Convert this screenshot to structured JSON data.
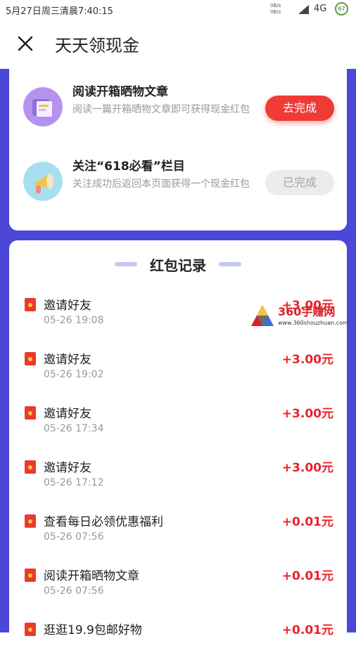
{
  "status_bar": {
    "time": "5月27日周三清晨7:40:15",
    "net_up": "0B/s",
    "net_down": "0B/s",
    "network": "4G",
    "battery": "67",
    "icons": [
      "signal-icon",
      "battery-icon"
    ]
  },
  "title_bar": {
    "close_icon": "close-icon",
    "title": "天天领现金"
  },
  "tasks": [
    {
      "title": "阅读开箱晒物文章",
      "desc": "阅读一篇开箱晒物文章即可获得现金红包",
      "button": "去完成",
      "state": "active",
      "icon": "article-icon",
      "icon_color": "#b493ef"
    },
    {
      "title": "关注“618必看”栏目",
      "desc": "关注成功后返回本页面获得一个现金红包",
      "button": "已完成",
      "state": "done",
      "icon": "megaphone-icon",
      "icon_color": "#a7dff0"
    }
  ],
  "records_title": "红包记录",
  "records": [
    {
      "name": "邀请好友",
      "date": "05-26 19:08",
      "amount": "+3.00元"
    },
    {
      "name": "邀请好友",
      "date": "05-26 19:02",
      "amount": "+3.00元"
    },
    {
      "name": "邀请好友",
      "date": "05-26 17:34",
      "amount": "+3.00元"
    },
    {
      "name": "邀请好友",
      "date": "05-26 17:12",
      "amount": "+3.00元"
    },
    {
      "name": "查看每日必领优惠福利",
      "date": "05-26 07:56",
      "amount": "+0.01元"
    },
    {
      "name": "阅读开箱晒物文章",
      "date": "05-26 07:56",
      "amount": "+0.01元"
    },
    {
      "name": "逛逛19.9包邮好物",
      "date": "",
      "amount": "+0.01元"
    }
  ],
  "watermark": {
    "text": "360手赚网",
    "url": "www.360shouzhuan.com"
  },
  "colors": {
    "accent": "#ef3a36",
    "amount": "#e8232b",
    "background": "#4b47d8",
    "done_button": "#ececec"
  }
}
